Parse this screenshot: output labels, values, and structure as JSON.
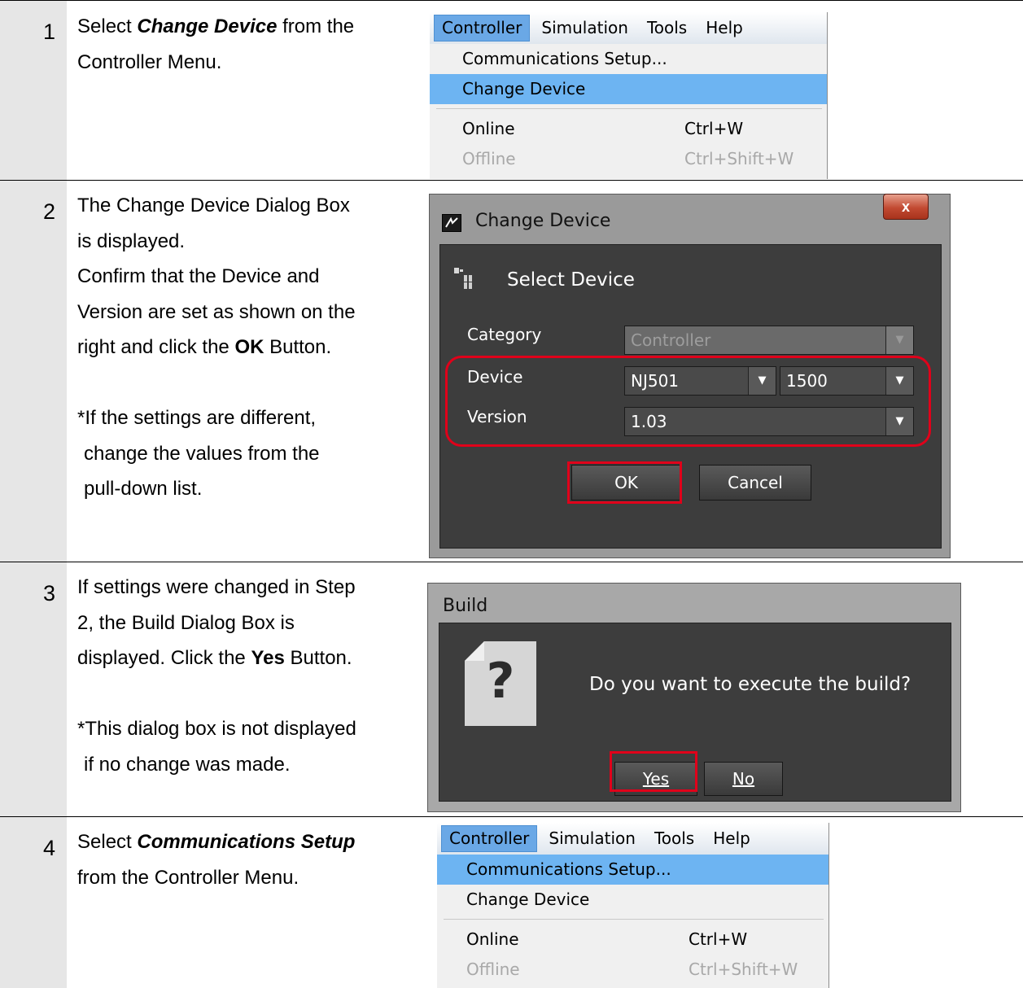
{
  "steps": [
    {
      "number": "1",
      "desc_pre": "Select ",
      "desc_emph": "Change Device",
      "desc_post": " from the",
      "desc_line2": "Controller Menu."
    },
    {
      "number": "2",
      "desc_lines": [
        "The Change Device Dialog Box",
        "is displayed.",
        "Confirm that the Device and",
        "Version are set as shown on the"
      ],
      "desc_ok_pre": "right and click the ",
      "desc_ok_bold": "OK",
      "desc_ok_post": " Button.",
      "note_lines": [
        "*If the settings are different,",
        "change the values from the",
        "pull-down list."
      ]
    },
    {
      "number": "3",
      "desc_lines": [
        "If settings were changed in Step",
        "2, the Build Dialog Box is"
      ],
      "desc_yes_pre": "displayed. Click the ",
      "desc_yes_bold": "Yes",
      "desc_yes_post": " Button.",
      "note_lines": [
        "*This dialog box is not displayed",
        "if no change was made."
      ]
    },
    {
      "number": "4",
      "desc_pre": "Select ",
      "desc_emph": "Communications Setup",
      "desc_line2": "from the Controller Menu."
    }
  ],
  "menu": {
    "bar": [
      "Controller",
      "Simulation",
      "Tools",
      "Help"
    ],
    "items": {
      "communications_setup": "Communications Setup...",
      "change_device": "Change Device",
      "online": "Online",
      "online_shortcut": "Ctrl+W",
      "offline": "Offline",
      "offline_shortcut": "Ctrl+Shift+W"
    }
  },
  "change_device_dialog": {
    "title": "Change Device",
    "close": "x",
    "header": "Select Device",
    "category_label": "Category",
    "category_value": "Controller",
    "device_label": "Device",
    "device_value": "NJ501",
    "device_separator": "-",
    "device_model": "1500",
    "version_label": "Version",
    "version_value": "1.03",
    "ok": "OK",
    "cancel": "Cancel"
  },
  "build_dialog": {
    "title": "Build",
    "question_mark": "?",
    "message": "Do you want to execute the build?",
    "yes": "Yes",
    "no": "No"
  },
  "colors": {
    "highlight": "#6db4f2",
    "callout_red": "#e0001a",
    "step_column": "#e6e6e6",
    "dialog_body": "#3d3d3d"
  }
}
